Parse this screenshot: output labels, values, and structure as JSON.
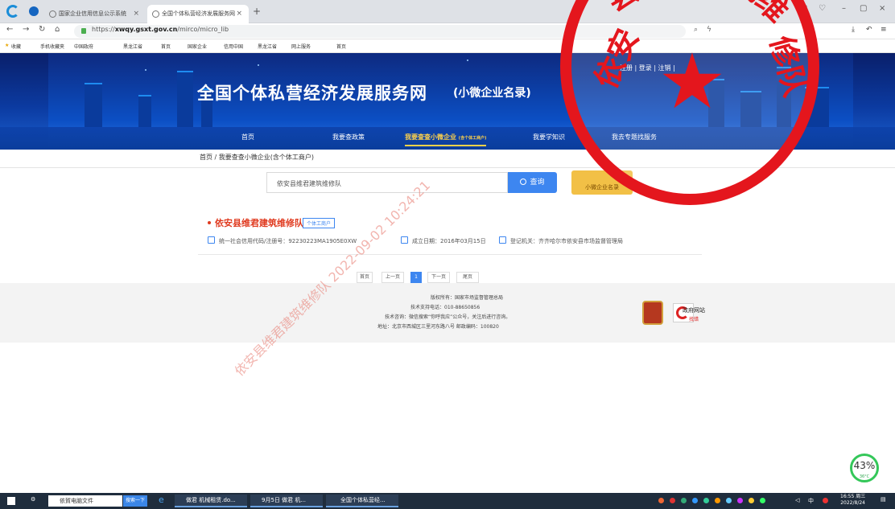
{
  "browser": {
    "tabs": [
      {
        "label": "国家企业信用信息公示系统"
      },
      {
        "label": "全国个体私营经济发展服务网"
      }
    ],
    "url_prefix": "https://",
    "url_host": "xwqy.gsxt.gov.cn",
    "url_path": "/mirco/micro_lib"
  },
  "bookmarks": [
    "收藏",
    "手机收藏夹",
    "中国政府",
    "黑龙江省",
    "首页",
    "国家企业",
    "信用中国",
    "黑龙江省",
    "网上服务",
    "首页"
  ],
  "site": {
    "title": "全国个体私营经济发展服务网",
    "subtitle": "(小微企业名录)",
    "top_links": "注册 | 登录 | 注销 |",
    "nav": [
      "首页",
      "我要查政策",
      "我要查查小微企业",
      "(含个体工商户)",
      "我要学知识",
      "我去专题找服务"
    ]
  },
  "breadcrumb": "首页 / 我要查查小微企业(含个体工商户)",
  "search": {
    "value": "依安县维君建筑维修队",
    "button": "查询",
    "yellow_button": "小微企业名录"
  },
  "result": {
    "name": "依安县维君建筑维修队",
    "tag": "个体工商户",
    "credit_code": "统一社会信用代码/注册号：92230223MA1905E0XW",
    "established": "成立日期：2016年03月15日",
    "authority": "登记机关：齐齐哈尔市依安县市场监督管理局"
  },
  "pagination": [
    "首页",
    "上一页",
    "1",
    "下一页",
    "尾页"
  ],
  "footer": {
    "lines": [
      "版权所有：国家市场监督管理总局",
      "技术支持电话：010-88650856",
      "技术咨询：微信搜索“你呼我应”公众号，关注后进行咨询。",
      "地址：北京市西城区三里河东路八号 邮政编码：100820"
    ],
    "gov_site": "政府网站",
    "gov_site_sub": "找错"
  },
  "watermark": "依安县维君建筑维修队 2022-09-02 10:24:21",
  "stamp": {
    "ring_text": "依安县维君建筑维修队"
  },
  "widget": {
    "percent": "43%",
    "temp": "36°C"
  },
  "taskbar": {
    "search_value": "依賀电脑文件",
    "search_button": "搜索一下",
    "apps": [
      "做君 机械租赁.do...",
      "9月5日 做君 机...",
      "全国个体私营经..."
    ],
    "time": "16:55 周三",
    "date": "2022/8/24"
  },
  "colors": {
    "banner": "#0c4fc4",
    "accent": "#3d86f0",
    "result_title": "#e03a1f",
    "stamp": "#e4161d",
    "yellow_button": "#f2c046"
  }
}
